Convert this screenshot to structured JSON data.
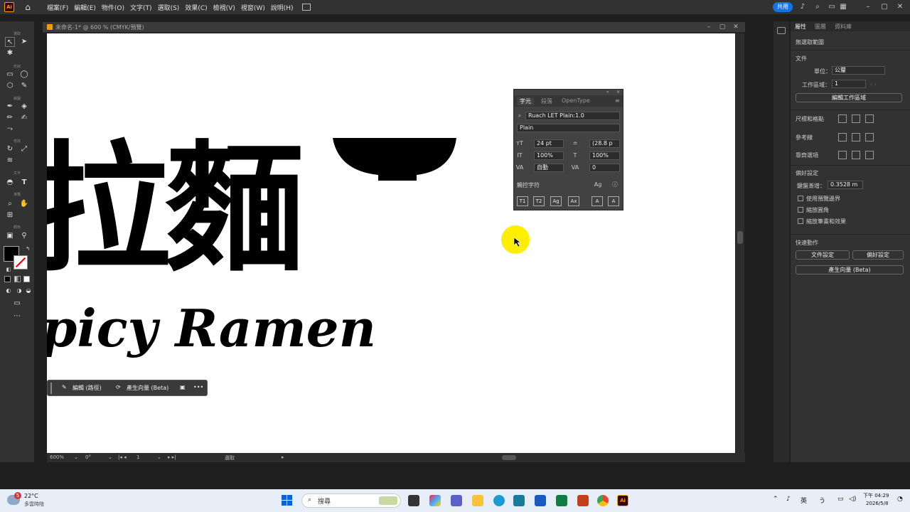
{
  "menubar": {
    "logo": "Ai",
    "items": [
      "檔案(F)",
      "編輯(E)",
      "物件(O)",
      "文字(T)",
      "選取(S)",
      "效果(C)",
      "檢視(V)",
      "視窗(W)",
      "說明(H)"
    ],
    "share_label": "共用"
  },
  "toolbar": {
    "labels": [
      "選取",
      "形狀",
      "繪圖",
      "修改",
      "文字",
      "導覽",
      "顏色"
    ]
  },
  "document": {
    "tab_title": "未命名-1* @ 600 % (CMYK/預覽)"
  },
  "artwork": {
    "chinese_text": "拉麵",
    "english_text": "picy Ramen"
  },
  "context_bar": {
    "edit_label": "編輯 (路徑)",
    "generate_label": "產生向量 (Beta)"
  },
  "char_panel": {
    "tabs": [
      "字元",
      "段落",
      "OpenType"
    ],
    "font_family": "Ruach LET Plain:1.0",
    "font_style": "Plain",
    "font_size": "24 pt",
    "leading": "(28.8 p",
    "vertical_scale": "100%",
    "horizontal_scale": "100%",
    "kerning": "自動",
    "tracking": "0",
    "touch_type_label": "觸控字符",
    "buttons": [
      "T1",
      "T2",
      "Ag",
      "Ax",
      "A",
      "A"
    ]
  },
  "statusbar": {
    "zoom": "600%",
    "rotation": "0°",
    "artboard": "1",
    "tool": "選取"
  },
  "properties": {
    "tabs": [
      "屬性",
      "圖層",
      "資料庫"
    ],
    "no_selection": "無選取範圍",
    "document_heading": "文件",
    "units_label": "單位：",
    "units_value": "公釐",
    "artboard_label": "工作區域：",
    "artboard_value": "1",
    "edit_artboards_button": "編輯工作區域",
    "rulers_grids_label": "尺標和格點",
    "guides_label": "參考線",
    "snap_label": "靠齊選項",
    "preferences_heading": "偏好設定",
    "keyboard_increment_label": "鍵盤漸增：",
    "keyboard_increment_value": "0.3528 m",
    "preview_bounds_label": "使用預覽邊界",
    "scale_corners_label": "縮放圓角",
    "scale_strokes_label": "縮放筆畫和效果",
    "quick_actions_heading": "快速動作",
    "document_setup_button": "文件設定",
    "preferences_button": "偏好設定",
    "generate_vectors_button": "產生向量 (Beta)"
  },
  "taskbar": {
    "weather_temp": "22°C",
    "weather_desc": "多雲時陰",
    "weather_badge": "5",
    "search_placeholder": "搜尋",
    "ime": "英",
    "time": "下午 04:29",
    "date": "2026/5/8"
  }
}
